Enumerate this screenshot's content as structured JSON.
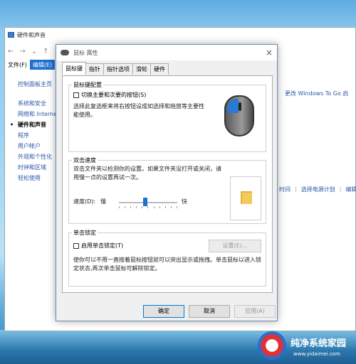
{
  "control_panel": {
    "title": "硬件和声音",
    "menu": [
      "文件(F)",
      "编辑(E)"
    ],
    "side_items": [
      "控制面板主页",
      "系统和安全",
      "网络和 Interne",
      "硬件和声音",
      "程序",
      "用户帐户",
      "外观和个性化",
      "时钟和区域",
      "轻松使用"
    ],
    "right_link1": "更改 Windows To Go 启",
    "right_links2": [
      "时间",
      "选择电源计划",
      "编辑"
    ]
  },
  "dialog": {
    "title": "鼠标 属性",
    "close": "×",
    "tabs": [
      "鼠标键",
      "指针",
      "指针选项",
      "滑轮",
      "硬件"
    ],
    "button_config": {
      "title": "鼠标键配置",
      "checkbox_label": "切换主要和次要的按钮(S)",
      "description": "选择此复选框来将右按钮设成如选择和拖放等主要性能使用。"
    },
    "double_click": {
      "title": "双击速度",
      "description": "双击文件夹以检测你的设置。如果文件夹没打开或关闭，请用慢一点的设置再试一次。",
      "speed_label": "速度(D):",
      "slow": "慢",
      "fast": "快",
      "speed_value": 0.45
    },
    "click_lock": {
      "title": "单击锁定",
      "checkbox_label": "启用单击锁定(T)",
      "settings_button": "设置(E)...",
      "description": "使你可以不用一直按着鼠标按钮就可以突出显示或拖拽。单击鼠标以进入锁定状态,再次单击鼠标可解除锁定。"
    },
    "buttons": {
      "ok": "确定",
      "cancel": "取消",
      "apply": "应用(A)"
    }
  },
  "watermark": {
    "brand": "纯净系统家园",
    "url": "www.yidaimei.com"
  }
}
